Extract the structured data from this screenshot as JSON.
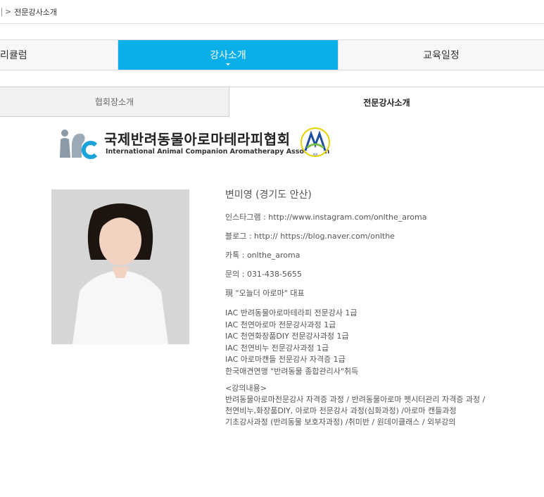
{
  "breadcrumb": {
    "sep": ">",
    "current": "전문강사소개"
  },
  "main_tabs": {
    "left": "리큘럼",
    "active": "강사소개",
    "right": "교육일정"
  },
  "sub_tabs": {
    "left": "협회장소개",
    "active": "전문강사소개"
  },
  "logo": {
    "title_ko": "국제반려동물아로마테라피협회",
    "title_en": "International Animal Companion Aromatherapy Association",
    "seal_text": "AIA"
  },
  "colors": {
    "accent": "#0aaee8",
    "logo_blue": "#1aa3d9",
    "logo_gray": "#8a9aa6"
  },
  "instructor": {
    "name": "변미영 (경기도 안산)",
    "instagram": "인스타그램 : http://www.instagram.com/onlthe_aroma",
    "blog": "블로그 : http:// https://blog.naver.com/onlthe",
    "kakao": "카톡 : onlthe_aroma",
    "contact": "문의 : 031-438-5655",
    "current": "現 \"오늘더 아로마\" 대표",
    "certs": [
      "IAC 반려동물아로마테라피 전문강사 1급",
      "IAC 천연아로마 전문강사과정 1급",
      "IAC 천연화장품DIY 전문강사과정 1급",
      "IAC 천연비누 전문강사과정 1급",
      "IAC 아로마캔들 전문강사 자격증 1급",
      "한국애견연맹 \"반려동물 종합관리사\"취득"
    ],
    "lecture_title": "<강의내용>",
    "lectures": [
      "반려동물아로마전문강사 자격증 과정 / 반려동물아로마 펫시터관리 자격증 과정 /",
      "천연비누,화장품DIY, 아로마 전문강사 과정(심화과정) /아로마 캔들과정",
      "기초강사과정 (반려동물 보호자과정) /취미반 / 원데이클래스 / 외부강의"
    ]
  }
}
